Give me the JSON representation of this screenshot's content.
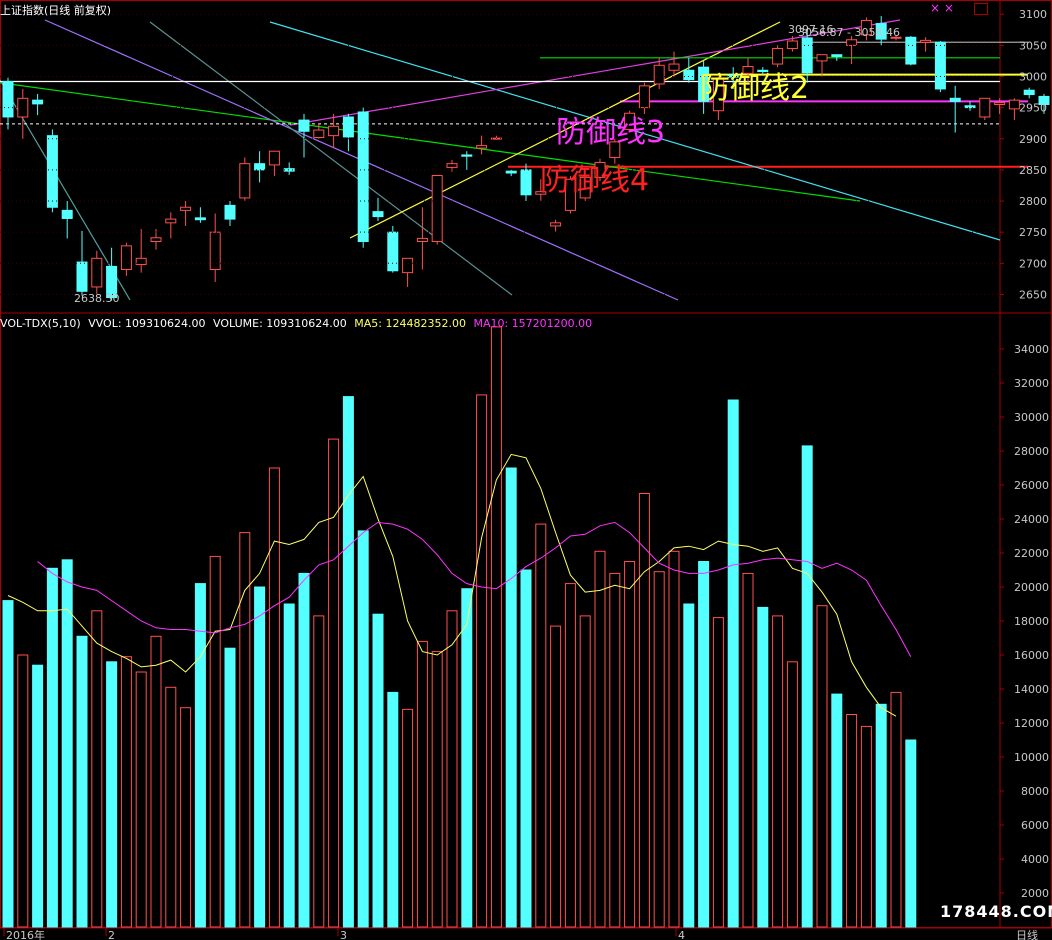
{
  "title": "上证指数(日线 前复权)",
  "price_panel": {
    "y_ticks": [
      "3100",
      "3050",
      "3000",
      "2950",
      "2900",
      "2850",
      "2800",
      "2750",
      "2700",
      "2650"
    ],
    "low_label": "2638.30",
    "high_label": "3097.16",
    "last_label": "3056.87 - 3058.46"
  },
  "defense_lines": [
    {
      "label": "防御线2",
      "value": 3003,
      "color": "#ffff33"
    },
    {
      "label": "防御线3",
      "value": 2960,
      "color": "#ff33ff"
    },
    {
      "label": "防御线4",
      "value": 2855,
      "color": "#ff2020"
    }
  ],
  "volume_header": {
    "indicator": "VOL-TDX(5,10)",
    "vvol": "VVOL: 109310624.00",
    "volume": "VOLUME: 109310624.00",
    "ma5": "MA5: 124482352.00",
    "ma10": "MA10: 157201200.00"
  },
  "volume_panel": {
    "y_ticks": [
      "34000",
      "32000",
      "30000",
      "28000",
      "26000",
      "24000",
      "22000",
      "20000",
      "18000",
      "16000",
      "14000",
      "12000",
      "10000",
      "8000",
      "6000",
      "4000",
      "2000"
    ]
  },
  "x_axis": {
    "labels": [
      "2016年",
      "2",
      "3",
      "4"
    ],
    "period": "日线"
  },
  "watermark": "178448.COM",
  "colors": {
    "up": "#ff5050",
    "down": "#54ffff",
    "frame": "#aa0000",
    "tick_text": "#c8c8c8",
    "ma5": "#ffff66",
    "ma10": "#ff33ff",
    "header_white": "#ffffff",
    "header_magenta": "#ff33ff"
  },
  "chart_data": [
    {
      "type": "candlestick",
      "title": "上证指数(日线 前复权)",
      "ylim": [
        2625,
        3110
      ],
      "series": [
        {
          "name": "上证指数",
          "ohlc": [
            [
              2992,
              2998,
              2915,
              2935
            ],
            [
              2935,
              2980,
              2900,
              2965
            ],
            [
              2962,
              2972,
              2938,
              2956
            ],
            [
              2905,
              2915,
              2782,
              2790
            ],
            [
              2785,
              2800,
              2740,
              2772
            ],
            [
              2702,
              2752,
              2648,
              2655
            ],
            [
              2662,
              2720,
              2650,
              2708
            ],
            [
              2695,
              2725,
              2640,
              2645
            ],
            [
              2690,
              2733,
              2680,
              2728
            ],
            [
              2698,
              2755,
              2685,
              2708
            ],
            [
              2735,
              2755,
              2722,
              2741
            ],
            [
              2765,
              2782,
              2740,
              2771
            ],
            [
              2785,
              2800,
              2760,
              2790
            ],
            [
              2773,
              2790,
              2765,
              2770
            ],
            [
              2690,
              2780,
              2670,
              2750
            ],
            [
              2793,
              2800,
              2760,
              2771
            ],
            [
              2805,
              2870,
              2800,
              2860
            ],
            [
              2860,
              2880,
              2830,
              2850
            ],
            [
              2858,
              2878,
              2840,
              2880
            ],
            [
              2852,
              2862,
              2842,
              2848
            ],
            [
              2930,
              2940,
              2870,
              2912
            ],
            [
              2902,
              2925,
              2900,
              2914
            ],
            [
              2905,
              2940,
              2885,
              2920
            ],
            [
              2935,
              2940,
              2880,
              2903
            ],
            [
              2943,
              2950,
              2725,
              2735
            ],
            [
              2783,
              2805,
              2768,
              2775
            ],
            [
              2750,
              2760,
              2685,
              2688
            ],
            [
              2685,
              2700,
              2662,
              2708
            ],
            [
              2735,
              2790,
              2690,
              2740
            ],
            [
              2735,
              2790,
              2730,
              2841
            ],
            [
              2854,
              2866,
              2847,
              2860
            ],
            [
              2874,
              2880,
              2850,
              2872
            ],
            [
              2885,
              2905,
              2875,
              2889
            ],
            [
              2900,
              2905,
              2898,
              2901
            ],
            [
              2848,
              2850,
              2840,
              2845
            ],
            [
              2850,
              2860,
              2800,
              2810
            ],
            [
              2811,
              2835,
              2800,
              2815
            ],
            [
              2760,
              2770,
              2751,
              2765
            ],
            [
              2785,
              2840,
              2780,
              2835
            ],
            [
              2805,
              2840,
              2800,
              2838
            ],
            [
              2838,
              2868,
              2832,
              2862
            ],
            [
              2870,
              2900,
              2860,
              2895
            ],
            [
              2915,
              2945,
              2910,
              2941
            ],
            [
              2950,
              2990,
              2940,
              2985
            ],
            [
              2988,
              3030,
              2980,
              3018
            ],
            [
              3010,
              3040,
              3000,
              3020
            ],
            [
              3010,
              3030,
              2990,
              2995
            ],
            [
              3015,
              3025,
              2940,
              2960
            ],
            [
              2945,
              3000,
              2930,
              2996
            ],
            [
              3002,
              3015,
              2980,
              2999
            ],
            [
              3005,
              3030,
              2990,
              3016
            ],
            [
              3010,
              3015,
              3003,
              3008
            ],
            [
              3020,
              3050,
              3015,
              3045
            ],
            [
              3045,
              3065,
              3040,
              3057
            ],
            [
              3062,
              3075,
              2990,
              3006
            ],
            [
              3025,
              3035,
              3000,
              3035
            ],
            [
              3035,
              3035,
              3025,
              3032
            ],
            [
              3050,
              3065,
              3020,
              3059
            ],
            [
              3067,
              3095,
              3058,
              3090
            ],
            [
              3085,
              3097,
              3050,
              3060
            ],
            [
              3062,
              3065,
              3058,
              3063
            ],
            [
              3063,
              3065,
              3018,
              3020
            ],
            [
              3055,
              3063,
              3040,
              3058
            ],
            [
              3055,
              3057,
              2975,
              2980
            ],
            [
              2965,
              2985,
              2910,
              2960
            ],
            [
              2953,
              2960,
              2945,
              2950
            ],
            [
              2935,
              2965,
              2930,
              2965
            ],
            [
              2955,
              2965,
              2940,
              2958
            ],
            [
              2948,
              2965,
              2930,
              2962
            ],
            [
              2978,
              2982,
              2965,
              2971
            ],
            [
              2968,
              2972,
              2940,
              2955
            ],
            [
              2940,
              2945,
              2935,
              2942
            ]
          ]
        }
      ]
    },
    {
      "type": "bar",
      "title": "VOL-TDX(5,10)",
      "ylim": [
        0,
        36000
      ],
      "series": [
        {
          "name": "VOLUME",
          "values": [
            19200,
            16000,
            15400,
            21100,
            21600,
            17100,
            18600,
            15600,
            15900,
            15000,
            17100,
            14100,
            12900,
            20200,
            21800,
            16400,
            23200,
            20000,
            27000,
            19000,
            20800,
            18300,
            28700,
            31200,
            23300,
            18400,
            13800,
            12800,
            16800,
            16200,
            18600,
            19900,
            31300,
            35300,
            27000,
            21000,
            23700,
            17700,
            20200,
            18300,
            22100,
            20800,
            21500,
            25500,
            20900,
            22100,
            19000,
            21500,
            18200,
            31000,
            20800,
            18800,
            18300,
            15600,
            28300,
            18900,
            13700,
            12500,
            11800,
            13100,
            13800,
            11000
          ]
        },
        {
          "name": "MA5",
          "values": [
            19500,
            19100,
            18600,
            18600,
            18700,
            17700,
            16700,
            16200,
            15800,
            15300,
            15400,
            15700,
            15000,
            15900,
            17400,
            17500,
            19800,
            20800,
            22700,
            22500,
            22800,
            23800,
            24100,
            25400,
            26500,
            24000,
            21800,
            18000,
            16200,
            16000,
            16600,
            17800,
            22900,
            26300,
            27800,
            27600,
            25800,
            23200,
            20700,
            19700,
            19800,
            20100,
            19900,
            20900,
            21500,
            22300,
            22400,
            22200,
            22700,
            22500,
            22400,
            22100,
            22300,
            21100,
            20800,
            19700,
            18400,
            15600,
            14100,
            12900,
            12400
          ]
        },
        {
          "name": "MA10",
          "values": [
            21500,
            20800,
            20300,
            20000,
            19800,
            19200,
            18600,
            18000,
            17600,
            17500,
            17500,
            17400,
            17300,
            17600,
            17800,
            18300,
            18900,
            19400,
            20400,
            21300,
            21600,
            22400,
            23200,
            23800,
            23700,
            23400,
            22800,
            21900,
            20800,
            20200,
            20000,
            19900,
            20500,
            21200,
            21700,
            22300,
            23000,
            23100,
            23600,
            23800,
            23200,
            22300,
            21400,
            21000,
            20800,
            20800,
            21000,
            21300,
            21400,
            21600,
            21700,
            21600,
            21500,
            21100,
            21400,
            21000,
            20400,
            18900,
            17500,
            15900
          ]
        }
      ]
    }
  ]
}
